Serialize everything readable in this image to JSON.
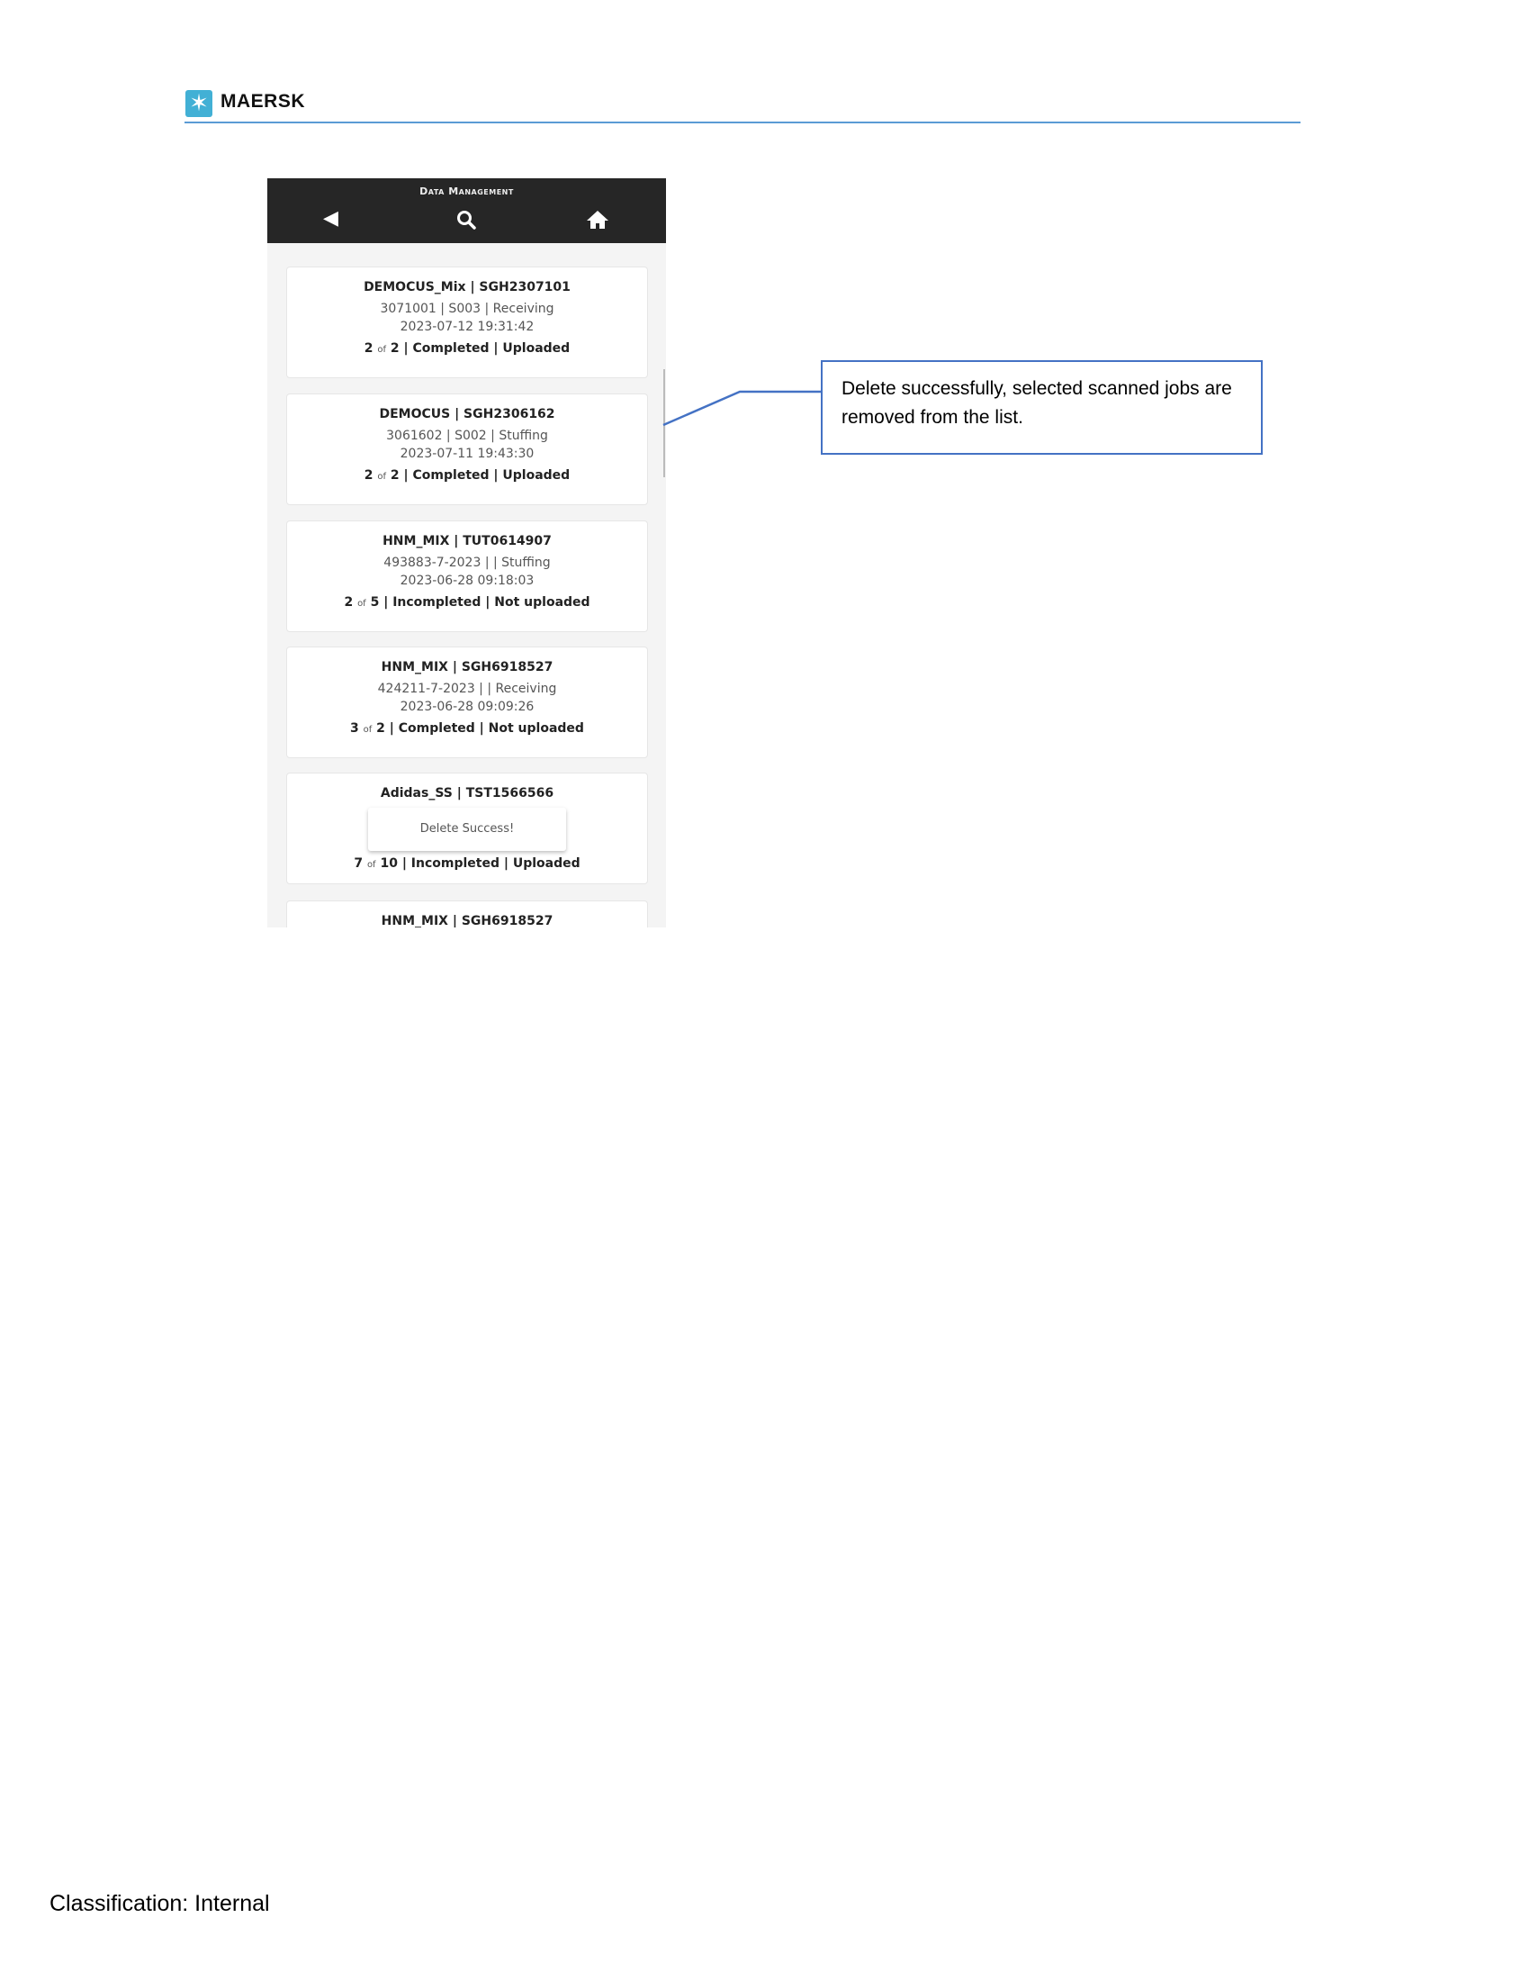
{
  "header": {
    "brand": "MAERSK",
    "logo_icon": "star-icon",
    "rule_color": "#5b9bd5"
  },
  "app": {
    "title": "Data Management",
    "icons": [
      "back-icon",
      "search-icon",
      "home-icon"
    ],
    "jobs": [
      {
        "title": "DEMOCUS_Mix | SGH2307101",
        "line1": "3071001 | S003 | Receiving",
        "line2": "2023-07-12 19:31:42",
        "done": "2",
        "of": "of",
        "total": "2",
        "status": "| Completed  | Uploaded"
      },
      {
        "title": "DEMOCUS | SGH2306162",
        "line1": "3061602 | S002 | Stuffing",
        "line2": "2023-07-11 19:43:30",
        "done": "2",
        "of": "of",
        "total": "2",
        "status": "| Completed  | Uploaded"
      },
      {
        "title": "HNM_MIX | TUT0614907",
        "line1": "493883-7-2023 |  | Stuffing",
        "line2": "2023-06-28 09:18:03",
        "done": "2",
        "of": "of",
        "total": "5",
        "status": "| Incompleted  | Not uploaded"
      },
      {
        "title": "HNM_MIX | SGH6918527",
        "line1": "424211-7-2023 |  | Receiving",
        "line2": "2023-06-28 09:09:26",
        "done": "3",
        "of": "of",
        "total": "2",
        "status": "| Completed  | Not uploaded"
      },
      {
        "title": "Adidas_SS | TST1566566",
        "done": "7",
        "of": "of",
        "total": "10",
        "status": "| Incompleted  | Uploaded"
      },
      {
        "title": "HNM_MIX | SGH6918527"
      }
    ],
    "toast": "Delete Success!"
  },
  "callout": {
    "text": "Delete successfully, selected scanned jobs are removed from the list.",
    "border_color": "#4472c4"
  },
  "footer": {
    "classification": "Classification: Internal"
  }
}
